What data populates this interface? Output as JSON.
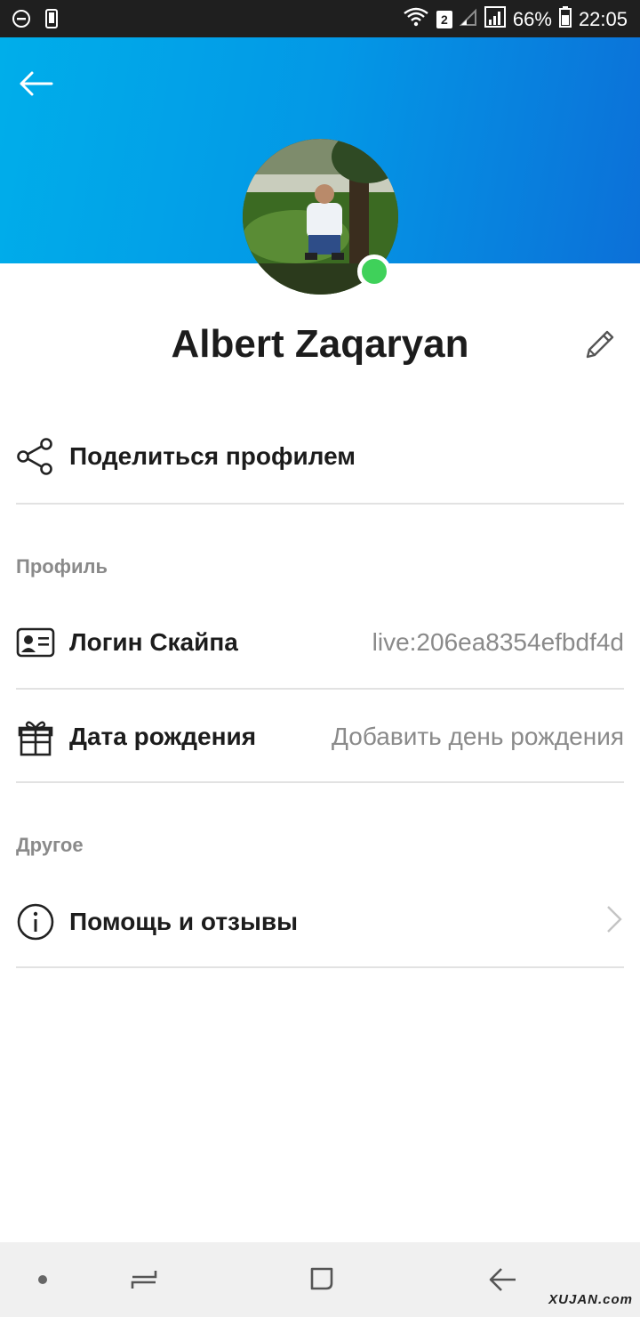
{
  "status_bar": {
    "battery_percent": "66%",
    "time": "22:05",
    "sim_number": "2"
  },
  "profile": {
    "name": "Albert Zaqaryan",
    "presence": "online",
    "presence_color": "#3fd15a"
  },
  "share": {
    "label": "Поделиться профилем",
    "icon": "share-icon"
  },
  "sections": {
    "profile_title": "Профиль",
    "other_title": "Другое"
  },
  "fields": {
    "skype_login_label": "Логин Скайпа",
    "skype_login_value": "live:206ea8354efbdf4d",
    "birthday_label": "Дата рождения",
    "birthday_value": "Добавить день рождения"
  },
  "other": {
    "help_label": "Помощь и отзывы"
  },
  "footer": {
    "watermark": "XUJAN.com"
  },
  "colors": {
    "header_gradient_start": "#00aeea",
    "header_gradient_end": "#0c70d8",
    "status_bar": "#1f1f1f",
    "nav_bar": "#f0f0f0"
  }
}
